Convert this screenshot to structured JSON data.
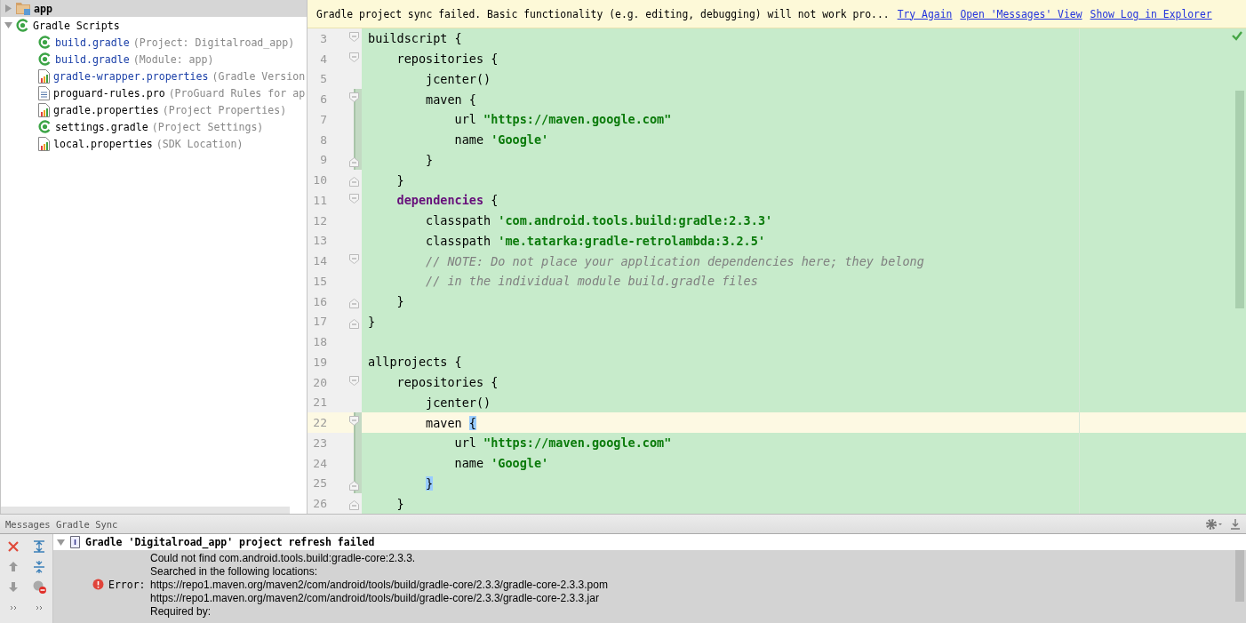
{
  "project_tree": {
    "items": [
      {
        "label": "app",
        "kind": "folder",
        "expanded": false,
        "selected": true
      },
      {
        "label": "Gradle Scripts",
        "kind": "gradle",
        "expanded": true,
        "selected": false,
        "children": [
          {
            "label": "build.gradle",
            "hint": "(Project: Digitalroad_app)",
            "kind": "gradle",
            "color": "#1a3fa8",
            "selected": false
          },
          {
            "label": "build.gradle",
            "hint": "(Module: app)",
            "kind": "gradle",
            "color": "#1a3fa8",
            "selected": false
          },
          {
            "label": "gradle-wrapper.properties",
            "hint": "(Gradle Version",
            "kind": "properties",
            "color": "#1a3fa8",
            "selected": false
          },
          {
            "label": "proguard-rules.pro",
            "hint": "(ProGuard Rules for ap",
            "kind": "text",
            "color": "#000000",
            "selected": false
          },
          {
            "label": "gradle.properties",
            "hint": "(Project Properties)",
            "kind": "properties",
            "color": "#000000",
            "selected": false
          },
          {
            "label": "settings.gradle",
            "hint": "(Project Settings)",
            "kind": "gradle",
            "color": "#000000",
            "selected": false
          },
          {
            "label": "local.properties",
            "hint": "(SDK Location)",
            "kind": "properties",
            "color": "#000000",
            "selected": false
          }
        ]
      }
    ]
  },
  "editor": {
    "banner": {
      "message": "Gradle project sync failed. Basic functionality (e.g. editing, debugging) will not work pro...",
      "links": [
        "Try Again",
        "Open 'Messages' View",
        "Show Log in Explorer"
      ]
    },
    "lines": [
      {
        "number": "3",
        "fold_start": true,
        "changed": false,
        "current": false,
        "tokens": [
          {
            "kind": "plain",
            "text": "buildscript {"
          }
        ],
        "children": [
          {
            "number": "4",
            "fold_start": true,
            "changed": false,
            "current": false,
            "tokens": [
              {
                "kind": "plain",
                "text": "repositories {"
              }
            ],
            "children": [
              {
                "number": "5",
                "changed": false,
                "current": false,
                "tokens": [
                  {
                    "kind": "plain",
                    "text": "jcenter()"
                  }
                ]
              },
              {
                "number": "6",
                "fold_start": true,
                "changed": true,
                "current": false,
                "tokens": [
                  {
                    "kind": "plain",
                    "text": "maven {"
                  }
                ],
                "children": [
                  {
                    "number": "7",
                    "changed": true,
                    "current": false,
                    "tokens": [
                      {
                        "kind": "plain",
                        "text": "url "
                      },
                      {
                        "kind": "string",
                        "text": "\"https://maven.google.com\""
                      }
                    ]
                  },
                  {
                    "number": "8",
                    "changed": true,
                    "current": false,
                    "tokens": [
                      {
                        "kind": "plain",
                        "text": "name "
                      },
                      {
                        "kind": "string",
                        "text": "'Google'"
                      }
                    ]
                  }
                ]
              },
              {
                "number": "9",
                "fold_end": true,
                "changed": true,
                "current": false,
                "tokens": [
                  {
                    "kind": "plain",
                    "text": "}"
                  }
                ]
              }
            ]
          },
          {
            "number": "10",
            "fold_end": true,
            "changed": false,
            "current": false,
            "tokens": [
              {
                "kind": "plain",
                "text": "}"
              }
            ]
          },
          {
            "number": "11",
            "fold_start": true,
            "changed": false,
            "current": false,
            "tokens": [
              {
                "kind": "keyword",
                "text": "dependencies"
              },
              {
                "kind": "plain",
                "text": " {"
              }
            ],
            "children": [
              {
                "number": "12",
                "changed": false,
                "current": false,
                "tokens": [
                  {
                    "kind": "plain",
                    "text": "classpath "
                  },
                  {
                    "kind": "string",
                    "text": "'com.android.tools.build:gradle:2.3.3'"
                  }
                ]
              },
              {
                "number": "13",
                "changed": false,
                "current": false,
                "tokens": [
                  {
                    "kind": "plain",
                    "text": "classpath "
                  },
                  {
                    "kind": "string",
                    "text": "'me.tatarka:gradle-retrolambda:3.2.5'"
                  }
                ]
              },
              {
                "number": "14",
                "fold_start": true,
                "changed": false,
                "current": false,
                "tokens": [
                  {
                    "kind": "comment",
                    "text": "// NOTE: Do not place your application dependencies here; they belong"
                  }
                ]
              },
              {
                "number": "15",
                "changed": false,
                "current": false,
                "tokens": [
                  {
                    "kind": "comment",
                    "text": "// in the individual module build.gradle files"
                  }
                ]
              }
            ]
          },
          {
            "number": "16",
            "fold_end": true,
            "changed": false,
            "current": false,
            "tokens": [
              {
                "kind": "plain",
                "text": "}"
              }
            ]
          }
        ]
      },
      {
        "number": "17",
        "fold_end": true,
        "changed": false,
        "current": false,
        "tokens": [
          {
            "kind": "plain",
            "text": "}"
          }
        ]
      },
      {
        "number": "18",
        "changed": false,
        "current": false
      },
      {
        "number": "19",
        "changed": false,
        "current": false,
        "tokens": [
          {
            "kind": "plain",
            "text": "allprojects {"
          }
        ],
        "children": [
          {
            "number": "20",
            "fold_start": true,
            "changed": false,
            "current": false,
            "tokens": [
              {
                "kind": "plain",
                "text": "repositories {"
              }
            ],
            "children": [
              {
                "number": "21",
                "changed": false,
                "current": false,
                "tokens": [
                  {
                    "kind": "plain",
                    "text": "jcenter()"
                  }
                ]
              },
              {
                "number": "22",
                "fold_start": true,
                "changed": true,
                "current": true,
                "tokens": [
                  {
                    "kind": "plain",
                    "text": "maven "
                  },
                  {
                    "kind": "brace",
                    "text": "{"
                  }
                ],
                "children": [
                  {
                    "number": "23",
                    "changed": true,
                    "current": false,
                    "tokens": [
                      {
                        "kind": "plain",
                        "text": "url "
                      },
                      {
                        "kind": "string",
                        "text": "\"https://maven.google.com\""
                      }
                    ]
                  },
                  {
                    "number": "24",
                    "changed": true,
                    "current": false,
                    "tokens": [
                      {
                        "kind": "plain",
                        "text": "name "
                      },
                      {
                        "kind": "string",
                        "text": "'Google'"
                      }
                    ]
                  }
                ]
              },
              {
                "number": "25",
                "fold_end": true,
                "changed": true,
                "current": false,
                "tokens": [
                  {
                    "kind": "brace",
                    "text": "}"
                  }
                ]
              }
            ]
          },
          {
            "number": "26",
            "fold_end": true,
            "changed": false,
            "current": false,
            "tokens": [
              {
                "kind": "plain",
                "text": "}"
              }
            ]
          }
        ]
      }
    ]
  },
  "messages_panel": {
    "title": "Messages Gradle Sync",
    "message": {
      "title": "Gradle 'Digitalroad_app' project refresh failed",
      "expanded": true,
      "severity": "Error:",
      "lines": [
        "Could not find com.android.tools.build:gradle-core:2.3.3.",
        "Searched in the following locations:",
        "https://repo1.maven.org/maven2/com/android/tools/build/gradle-core/2.3.3/gradle-core-2.3.3.pom",
        "https://repo1.maven.org/maven2/com/android/tools/build/gradle-core/2.3.3/gradle-core-2.3.3.jar",
        "Required by:"
      ]
    }
  }
}
